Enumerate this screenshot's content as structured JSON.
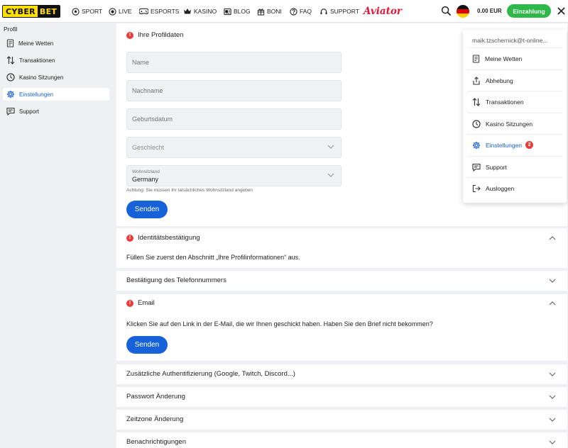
{
  "header": {
    "logo_left": "CYBER",
    "logo_right": "BET",
    "nav": [
      {
        "label": "SPORT",
        "icon": "soccer-ball-icon"
      },
      {
        "label": "LIVE",
        "icon": "live-icon"
      },
      {
        "label": "ESPORTS",
        "icon": "gamepad-icon"
      },
      {
        "label": "KASINO",
        "icon": "crown-icon"
      },
      {
        "label": "BLOG",
        "icon": "newspaper-icon"
      },
      {
        "label": "BONI",
        "icon": "gift-icon"
      },
      {
        "label": "FAQ",
        "icon": "question-icon"
      },
      {
        "label": "SUPPORT",
        "icon": "headset-icon"
      }
    ],
    "aviator": "Aviator",
    "balance": "0.00 EUR",
    "deposit_label": "Einzahlung",
    "accent": "#2fb84a"
  },
  "sidebar": {
    "title": "Profil",
    "items": [
      {
        "label": "Meine Wetten",
        "icon": "receipt-icon"
      },
      {
        "label": "Transaktionen",
        "icon": "transfer-arrows-icon"
      },
      {
        "label": "Kasino Sitzungen",
        "icon": "clock-icon"
      },
      {
        "label": "Einstellungen",
        "icon": "gear-icon",
        "active": true
      },
      {
        "label": "Support",
        "icon": "chat-icon"
      }
    ]
  },
  "profile": {
    "title": "Ihre Profildaten",
    "name_placeholder": "Name",
    "lastname_placeholder": "Nachname",
    "birthdate_placeholder": "Geburtsdatum",
    "gender_placeholder": "Geschlecht",
    "residence_label": "Wohnsitzland",
    "residence_value": "Germany",
    "warning": "Achtung: Sie müssen Ihr tatsächliches Wohnsitzland angeben",
    "submit": "Senden"
  },
  "identity": {
    "title": "Identitätsbestätigung",
    "text": "Füllen Sie zuerst den Abschnitt „Ihre Profilinformationen“ aus."
  },
  "phone": {
    "title": "Bestätigung des Telefonnummers"
  },
  "email": {
    "title": "Email",
    "text": "Klicken Sie auf den Link in der E-Mail, die wir Ihnen geschickt haben. Haben Sie den Brief nicht bekommen?",
    "submit": "Senden"
  },
  "sections": {
    "auth": "Zusätzliche Authentifizierung (Google, Twitch, Discord...)",
    "password": "Passwort Änderung",
    "timezone": "Zeitzone Änderung",
    "notifications": "Benachrichtigungen"
  },
  "menu": {
    "user": "maik.tzschernick@t-online...",
    "items": [
      {
        "label": "Meine Wetten",
        "icon": "receipt-icon"
      },
      {
        "label": "Abhebung",
        "icon": "withdraw-icon"
      },
      {
        "label": "Transaktionen",
        "icon": "transfer-arrows-icon"
      },
      {
        "label": "Kasino Sitzungen",
        "icon": "clock-icon"
      },
      {
        "label": "Einstellungen",
        "icon": "gear-icon",
        "badge": "2",
        "active": true
      },
      {
        "label": "Support",
        "icon": "chat-icon"
      },
      {
        "label": "Ausloggen",
        "icon": "logout-icon"
      }
    ]
  },
  "colors": {
    "primary": "#1762d8",
    "alert": "#e63e3e"
  }
}
